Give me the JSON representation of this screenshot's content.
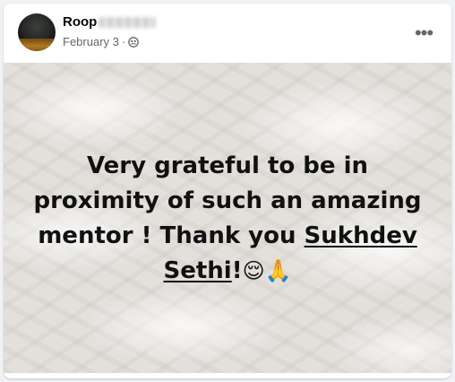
{
  "post": {
    "author_name": "Roop",
    "date": "February 3",
    "separator": "·",
    "audience_icon": "friends-icon",
    "more_icon": "more-options-icon",
    "more_label": "•••",
    "text_before": "Very grateful to be in proximity of such an amazing mentor ! Thank you ",
    "tagged_name": "Sukhdev Sethi",
    "text_after": "!",
    "emojis": "😌🙏"
  }
}
